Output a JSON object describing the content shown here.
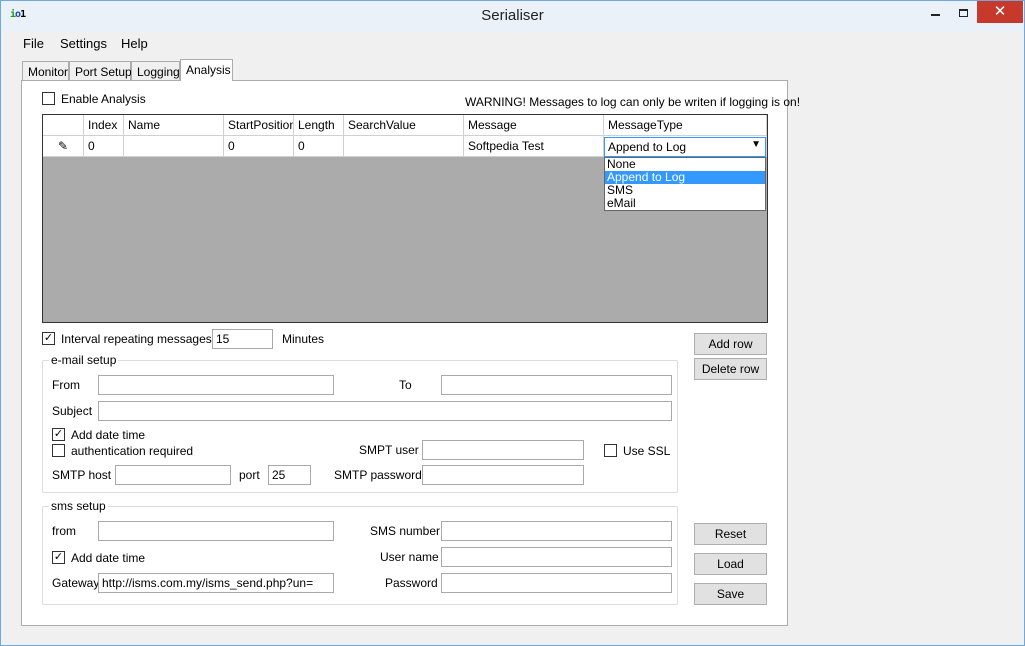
{
  "window": {
    "title": "Serialiser",
    "icon_label": "io1",
    "minimize_icon": "minimize-icon",
    "maximize_icon": "maximize-icon",
    "close_icon": "close-icon",
    "close_glyph": "✕"
  },
  "menu": [
    "File",
    "Settings",
    "Help"
  ],
  "tabs": [
    {
      "label": "Monitor",
      "active": false
    },
    {
      "label": "Port Setup",
      "active": false
    },
    {
      "label": "Logging",
      "active": false
    },
    {
      "label": "Analysis",
      "active": true
    }
  ],
  "analysis": {
    "enable_label": "Enable Analysis",
    "enable_checked": false,
    "warning": "WARNING! Messages to log can only be writen if logging is on!",
    "grid": {
      "columns": [
        "Index",
        "Name",
        "StartPosition",
        "Length",
        "SearchValue",
        "Message",
        "MessageType"
      ],
      "row": {
        "marker": "✎",
        "index": "0",
        "name": "",
        "start_position": "0",
        "length": "0",
        "search_value": "",
        "message": "Softpedia Test",
        "message_type": "Append to Log"
      },
      "dropdown_options": [
        "None",
        "Append to Log",
        "SMS",
        "eMail"
      ],
      "dropdown_selected": "Append to Log"
    },
    "interval": {
      "checked": true,
      "label": "Interval repeating messages for",
      "value": "15",
      "unit": "Minutes"
    },
    "buttons": {
      "add_row": "Add row",
      "delete_row": "Delete row",
      "reset": "Reset",
      "load": "Load",
      "save": "Save"
    },
    "email": {
      "title": "e-mail setup",
      "from_label": "From",
      "from_value": "",
      "to_label": "To",
      "to_value": "",
      "subject_label": "Subject",
      "subject_value": "",
      "add_date_label": "Add date  time",
      "add_date_checked": true,
      "auth_label": "authentication required",
      "auth_checked": false,
      "smpt_user_label": "SMPT user",
      "smpt_user_value": "",
      "use_ssl_label": "Use SSL",
      "use_ssl_checked": false,
      "smtp_host_label": "SMTP host",
      "smtp_host_value": "",
      "port_label": "port",
      "port_value": "25",
      "smtp_password_label": "SMTP password",
      "smtp_password_value": ""
    },
    "sms": {
      "title": "sms setup",
      "from_label": "from",
      "from_value": "",
      "sms_number_label": "SMS number",
      "sms_number_value": "",
      "add_date_label": "Add date  time",
      "add_date_checked": true,
      "user_name_label": "User name",
      "user_name_value": "",
      "gateway_label": "Gateway",
      "gateway_value": "http://isms.com.my/isms_send.php?un=",
      "password_label": "Password",
      "password_value": ""
    }
  }
}
